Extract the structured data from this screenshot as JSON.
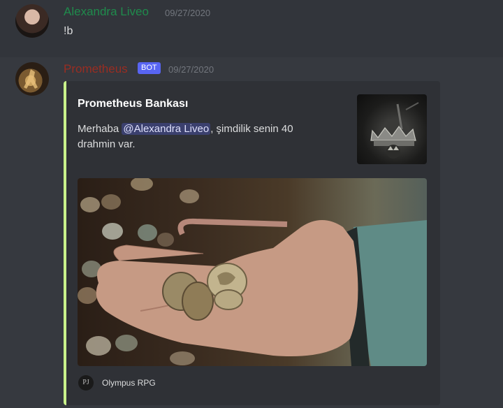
{
  "message1": {
    "username": "Alexandra Liveo",
    "timestamp": "09/27/2020",
    "text": "!b",
    "username_color": "#1f8b4c"
  },
  "message2": {
    "username": "Prometheus",
    "badge": "BOT",
    "timestamp": "09/27/2020",
    "username_color": "#992d22",
    "embed": {
      "accent_color": "#c9f28a",
      "title": "Prometheus Bankası",
      "desc_prefix": "Merhaba ",
      "mention": "@Alexandra Liveo",
      "desc_suffix": ", şimdilik senin 40 drahmin var.",
      "thumbnail_icon": "crown-icon",
      "image_icon": "coins-in-hand-image",
      "footer_icon_text": "PJ",
      "footer_text": "Olympus RPG"
    }
  }
}
